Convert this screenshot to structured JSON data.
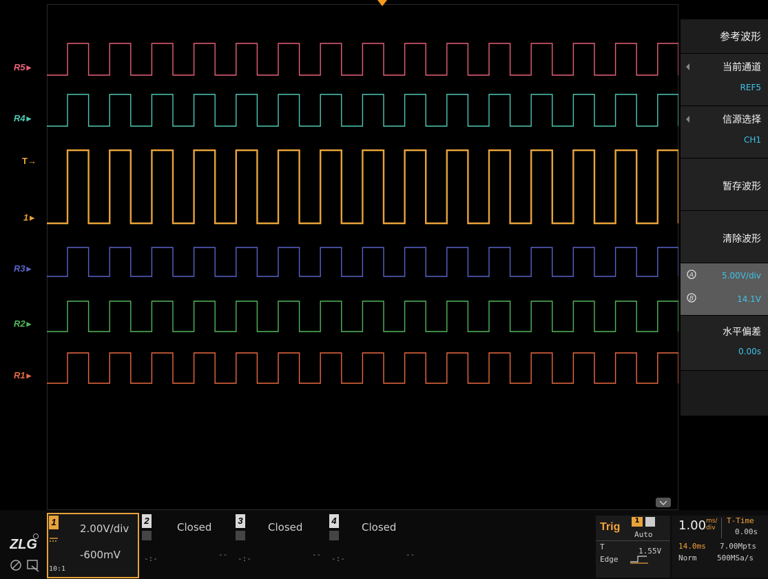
{
  "waveforms": [
    {
      "id": "R5",
      "label": "R5",
      "color": "#e8617a",
      "high": 57,
      "low": 103
    },
    {
      "id": "R4",
      "label": "R4",
      "color": "#4fc9b4",
      "high": 131,
      "low": 177
    },
    {
      "id": "CH1",
      "label": "1",
      "color": "#e8a33a",
      "high": 212,
      "low": 318
    },
    {
      "id": "R3",
      "label": "R3",
      "color": "#5a63c9",
      "high": 353,
      "low": 395
    },
    {
      "id": "R2",
      "label": "R2",
      "color": "#52b85c",
      "high": 431,
      "low": 475
    },
    {
      "id": "R1",
      "label": "R1",
      "color": "#ea6a41",
      "high": 506,
      "low": 550
    }
  ],
  "trigger_marker": {
    "label": "T",
    "color": "#f3a23a"
  },
  "side_menu": {
    "title": "参考波形",
    "current_channel_label": "当前通道",
    "current_channel_value": "REF5",
    "source_label": "信源选择",
    "source_value": "CH1",
    "save_label": "暂存波形",
    "clear_label": "清除波形",
    "knob_a_value": "5.00V/div",
    "knob_b_value": "14.1V",
    "h_offset_label": "水平偏差",
    "h_offset_value": "0.00s"
  },
  "channels": [
    {
      "num": "1",
      "scale": "2.00V/div",
      "offset": "-600mV",
      "probe": "10:1"
    },
    {
      "num": "2",
      "status": "Closed",
      "a": "-:-",
      "b": "--"
    },
    {
      "num": "3",
      "status": "Closed",
      "a": "-:-",
      "b": "--"
    },
    {
      "num": "4",
      "status": "Closed",
      "a": "-:-",
      "b": "--"
    }
  ],
  "trigger": {
    "label": "Trig",
    "source": "1",
    "mode": "Auto",
    "level_label": "T",
    "level": "1.55V",
    "type": "Edge"
  },
  "timebase": {
    "scale": "1.00",
    "unit_top": "ms/",
    "unit_bottom": "div",
    "ttime_label": "T-Time",
    "ttime": "0.00s",
    "window": "14.0ms",
    "points": "7.00Mpts",
    "mode": "Norm",
    "rate": "500MSa/s"
  },
  "brand": {
    "logo": "ZLG"
  }
}
